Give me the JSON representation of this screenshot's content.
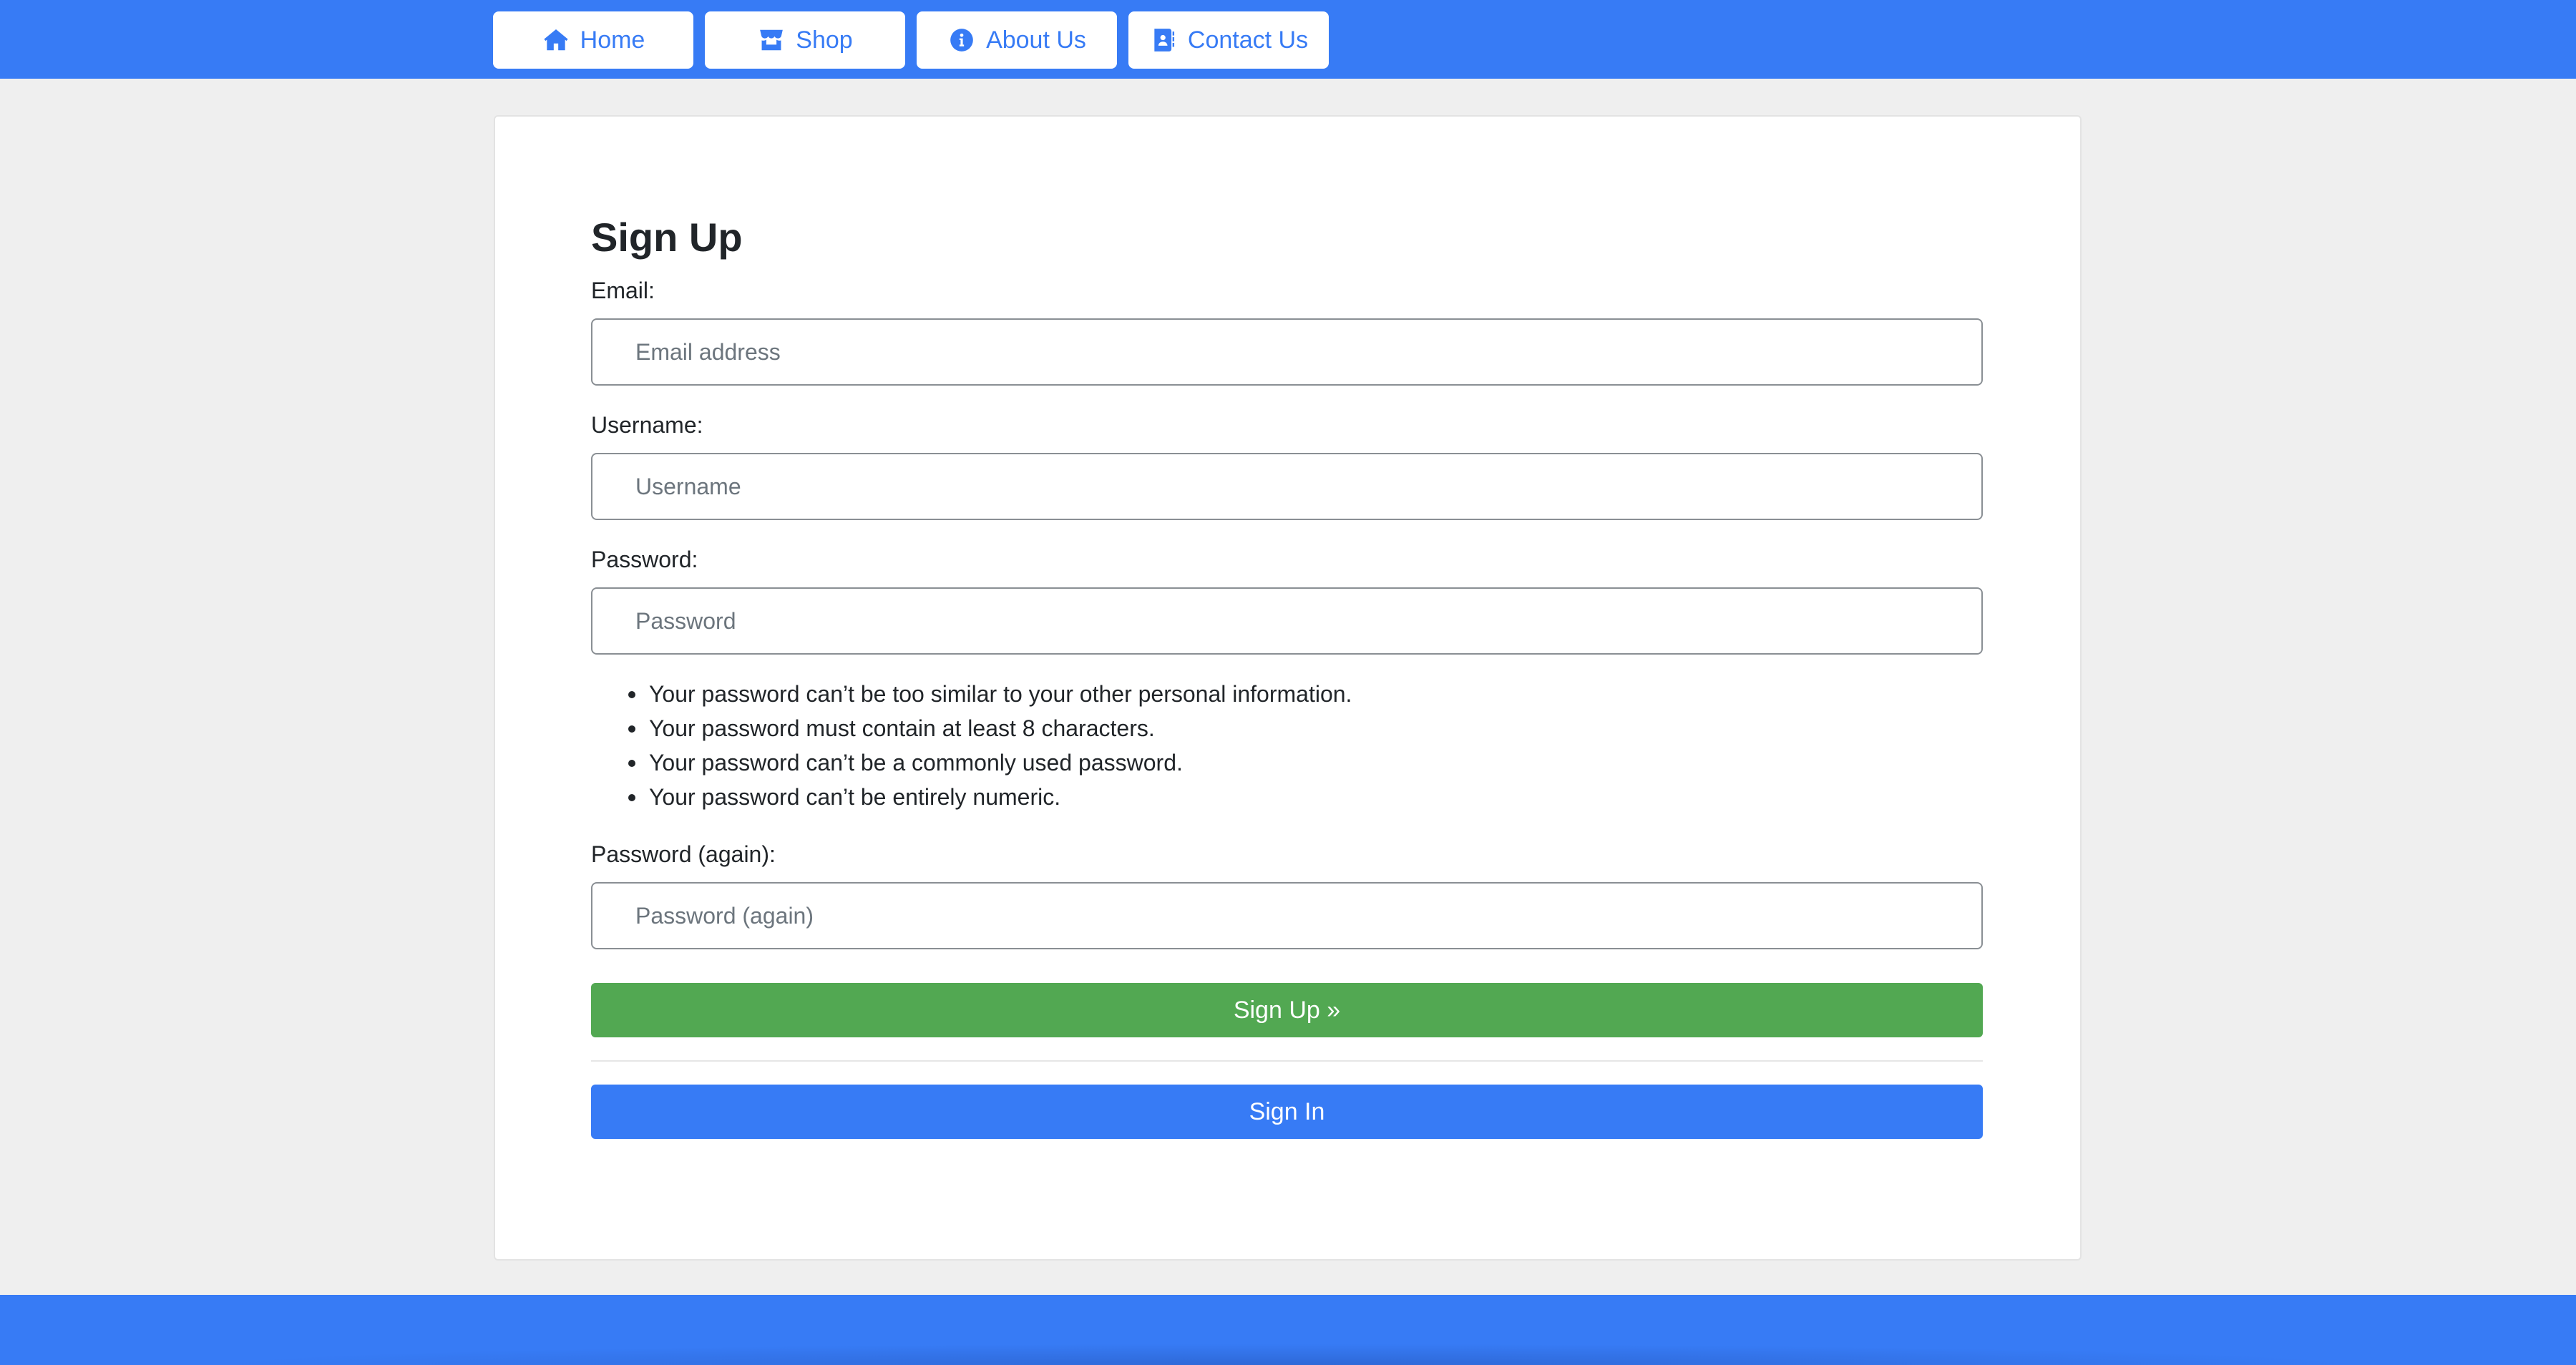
{
  "nav": {
    "items": [
      {
        "label": "Home",
        "icon": "home-icon"
      },
      {
        "label": "Shop",
        "icon": "store-icon"
      },
      {
        "label": "About Us",
        "icon": "info-icon"
      },
      {
        "label": "Contact Us",
        "icon": "contact-book-icon"
      }
    ]
  },
  "form": {
    "title": "Sign Up",
    "email": {
      "label": "Email:",
      "placeholder": "Email address"
    },
    "username": {
      "label": "Username:",
      "placeholder": "Username"
    },
    "password": {
      "label": "Password:",
      "placeholder": "Password"
    },
    "password_help": [
      "Your password can’t be too similar to your other personal information.",
      "Your password must contain at least 8 characters.",
      "Your password can’t be a commonly used password.",
      "Your password can’t be entirely numeric."
    ],
    "password2": {
      "label": "Password (again):",
      "placeholder": "Password (again)"
    },
    "signup_button": "Sign Up »",
    "signin_button": "Sign In"
  },
  "colors": {
    "primary": "#377bf5",
    "success": "#52a852",
    "page_bg": "#efefef"
  }
}
